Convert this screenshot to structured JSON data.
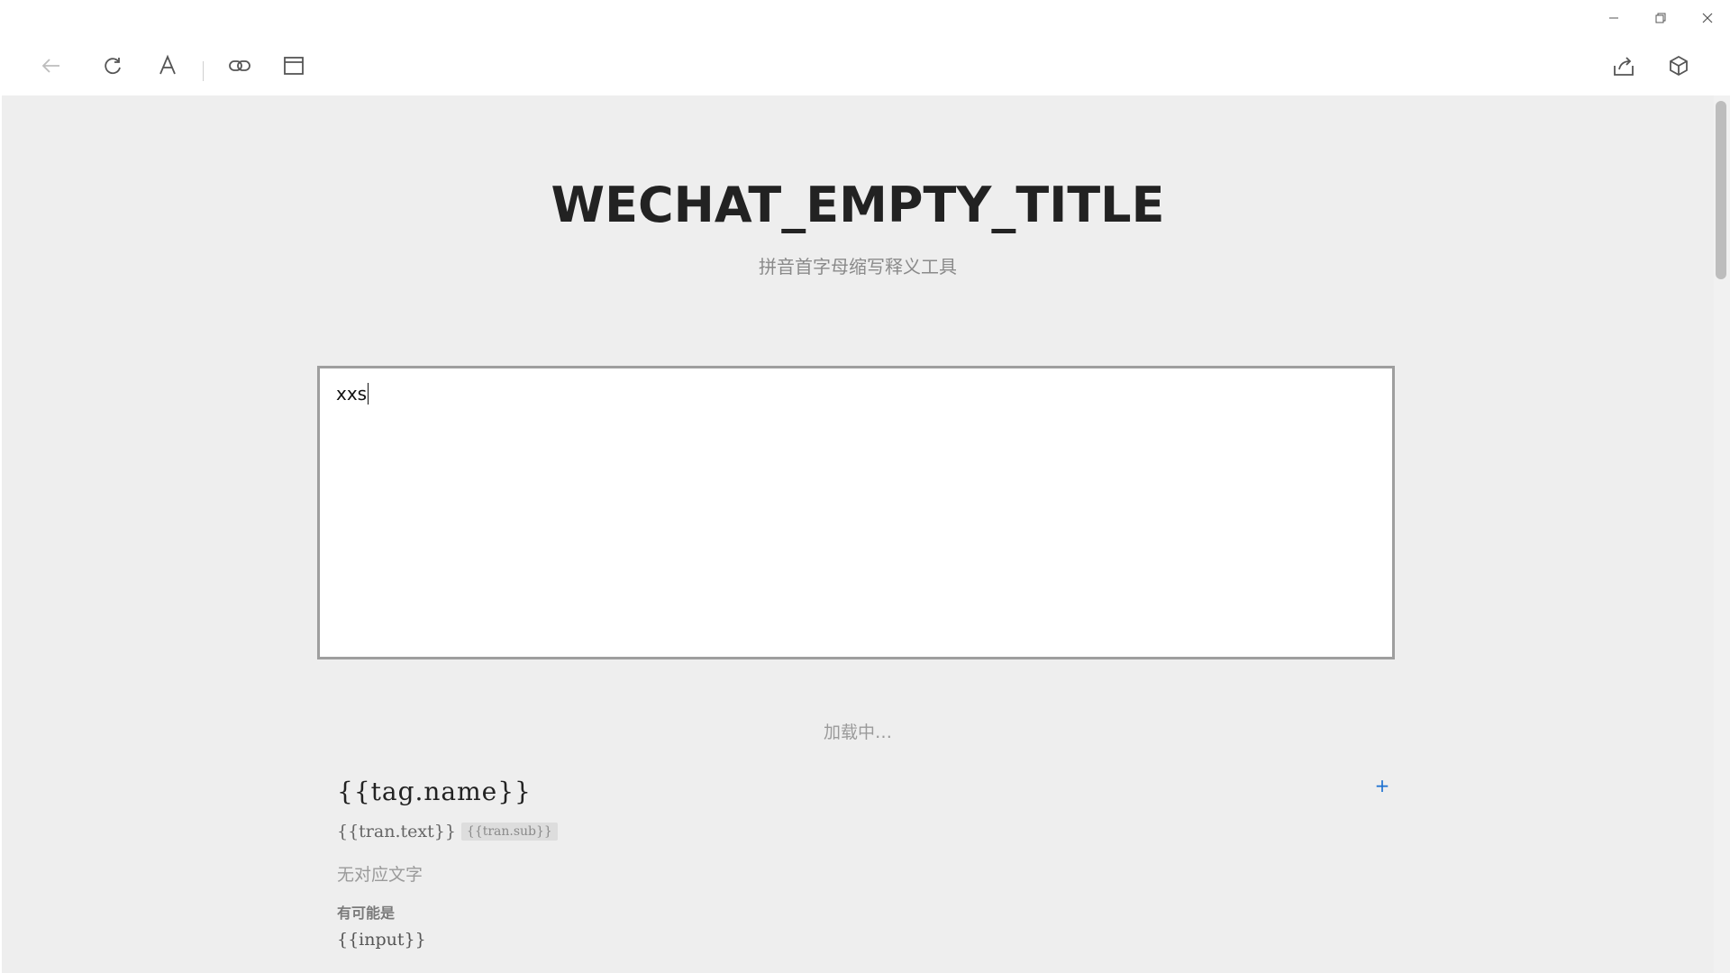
{
  "window": {
    "controls": {
      "minimize_icon": "minimize-icon",
      "restore_icon": "restore-icon",
      "close_icon": "close-icon"
    }
  },
  "toolbar": {
    "left": [
      "back-arrow-icon",
      "refresh-icon",
      "font-icon",
      "link-icon",
      "window-icon"
    ],
    "right": [
      "share-icon",
      "cube-icon"
    ]
  },
  "main": {
    "title": "WECHAT_EMPTY_TITLE",
    "subtitle": "拼音首字母缩写释义工具",
    "input_value": "xxs",
    "loading_text": "加载中…",
    "result": {
      "tag_name": "{{tag.name}}",
      "add_label": "+",
      "tran_text": "{{tran.text}}",
      "tran_sub": "{{tran.sub}}",
      "no_text": "无对应文字",
      "maybe_label": "有可能是",
      "maybe_input": "{{input}}"
    }
  },
  "colors": {
    "content_bg": "#eeeeee",
    "accent": "#1a6fd0",
    "title": "#222222"
  }
}
